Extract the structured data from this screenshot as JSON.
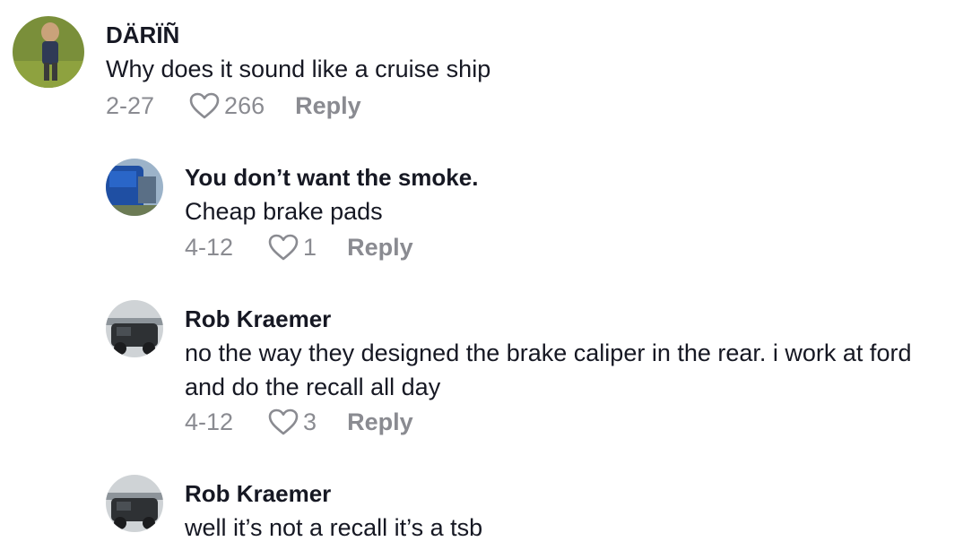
{
  "comments": [
    {
      "author": "DÄRÏÑ",
      "text": "Why does it sound like a cruise ship",
      "date": "2-27",
      "likes": "266",
      "reply_label": "Reply"
    },
    {
      "author": "You don’t want the smoke.",
      "text": "Cheap brake pads",
      "date": "4-12",
      "likes": "1",
      "reply_label": "Reply"
    },
    {
      "author": "Rob Kraemer",
      "text": "no the way they designed the brake caliper in the rear. i work at ford and do the recall all day",
      "date": "4-12",
      "likes": "3",
      "reply_label": "Reply"
    },
    {
      "author": "Rob Kraemer",
      "text": "well it’s not a recall it’s a tsb"
    }
  ],
  "icons": {
    "like": "heart-outline-icon"
  },
  "colors": {
    "text": "#161823",
    "muted": "#8a8b91",
    "background": "#ffffff"
  }
}
